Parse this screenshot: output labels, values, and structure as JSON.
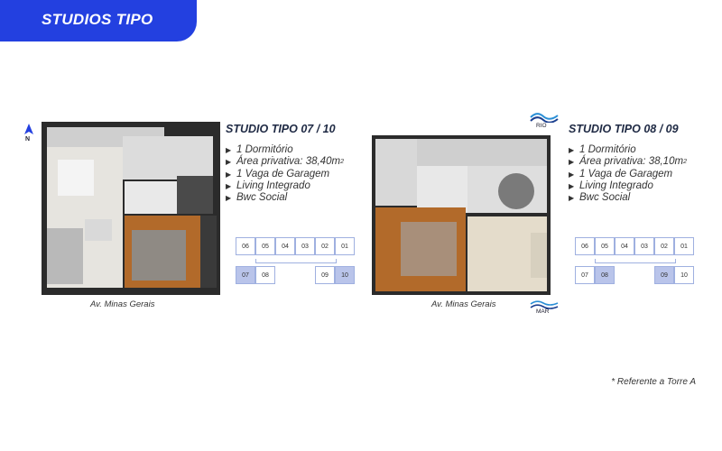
{
  "header": {
    "title": "STUDIOS TIPO",
    "accent_color": "#2340e0"
  },
  "compass": {
    "letter": "N",
    "icon": "north-arrow-icon"
  },
  "studio_a": {
    "title": "STUDIO TIPO 07 / 10",
    "features": [
      "1 Dormitório",
      "Área privativa: 38,40m",
      "1 Vaga de Garagem",
      "Living Integrado",
      "Bwc Social"
    ],
    "area_sup": "2",
    "street": "Av. Minas Gerais",
    "grid_top": [
      "06",
      "05",
      "04",
      "03",
      "02",
      "01"
    ],
    "grid_bottom_left": [
      "07",
      "08"
    ],
    "grid_bottom_right": [
      "09",
      "10"
    ],
    "highlight": [
      "07",
      "10"
    ]
  },
  "studio_b": {
    "title": "STUDIO TIPO 08 / 09",
    "features": [
      "1 Dormitório",
      "Área privativa: 38,10m",
      "1 Vaga de Garagem",
      "Living Integrado",
      "Bwc Social"
    ],
    "area_sup": "2",
    "street": "Av. Minas Gerais",
    "grid_top": [
      "06",
      "05",
      "04",
      "03",
      "02",
      "01"
    ],
    "grid_bottom_left": [
      "07",
      "08"
    ],
    "grid_bottom_right": [
      "09",
      "10"
    ],
    "highlight": [
      "08",
      "09"
    ]
  },
  "logos": {
    "rio": "RIO",
    "mar": "MAR"
  },
  "footnote": "* Referente a Torre A"
}
